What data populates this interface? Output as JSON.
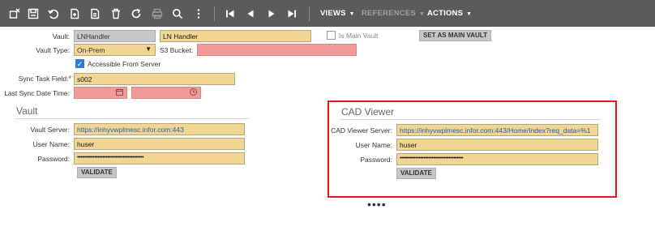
{
  "toolbar": {
    "menus": {
      "views": "VIEWS",
      "references": "REFERENCES",
      "actions": "ACTIONS"
    },
    "icons": [
      "close-record-icon",
      "save-icon",
      "undo-icon",
      "new-record-icon",
      "copy-icon",
      "delete-icon",
      "refresh-icon",
      "print-icon",
      "search-icon",
      "first-record-icon",
      "previous-record-icon",
      "next-record-icon",
      "last-record-icon"
    ],
    "colors": {
      "background": "#5b5b5b",
      "disabled": "#9e9e9e"
    }
  },
  "form": {
    "vault": {
      "label": "Vault:",
      "code": "LNHandler",
      "name": "LN Handler"
    },
    "is_main_vault": {
      "label": "Is Main Vault"
    },
    "set_main_vault_button": "SET AS MAIN VAULT",
    "vault_type": {
      "label": "Vault Type:",
      "value": "On-Prem"
    },
    "s3_bucket": {
      "label": "S3 Bucket:",
      "value": ""
    },
    "accessible_from_server": {
      "label": "Accessible From Server",
      "checked": true
    },
    "sync_task_field": {
      "label": "Sync Task Field:",
      "required_mark": "*",
      "value": "s002"
    },
    "last_sync_date_time": {
      "label": "Last Sync Date Time:",
      "date": "",
      "time": ""
    }
  },
  "vault_section": {
    "title": "Vault",
    "server": {
      "label": "Vault Server:",
      "value": "https://inhyvwplmesc.infor.com:443"
    },
    "user": {
      "label": "User Name:",
      "value": "huser"
    },
    "password": {
      "label": "Password:",
      "value": "••••••••••••••••••••••••••••••••••••••••••"
    },
    "validate_button": "VALIDATE"
  },
  "cad_section": {
    "title": "CAD Viewer",
    "server": {
      "label": "CAD Viewer Server:",
      "value": "https://inhyvwplmesc.infor.com:443/Home/Index?req_data=%1"
    },
    "user": {
      "label": "User Name:",
      "value": "huser"
    },
    "password": {
      "label": "Password:",
      "value": "••••••••••••••••••••••••••••••••••••••••"
    },
    "validate_button": "VALIDATE",
    "highlight_color": "#e0141c"
  },
  "more_indicator": "••••",
  "colors": {
    "field_bg": "#f1d593",
    "error_bg": "#f19a9a",
    "readonly_bg": "#c8c8c8",
    "link": "#2560b3"
  }
}
